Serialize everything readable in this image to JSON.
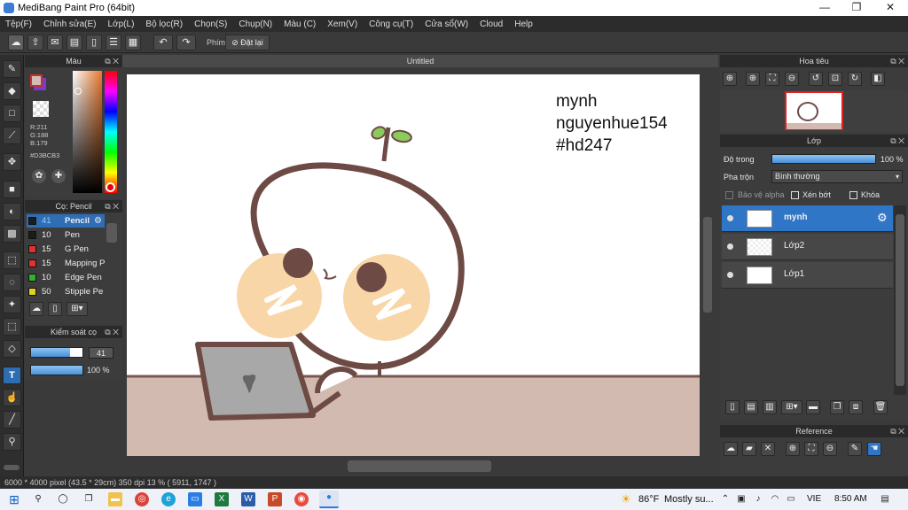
{
  "window": {
    "title": "MediBang Paint Pro (64bit)",
    "minimize": "—",
    "maximize": "❐",
    "close": "✕"
  },
  "menu": [
    "Tệp(F)",
    "Chỉnh sửa(E)",
    "Lớp(L)",
    "Bộ lọc(R)",
    "Chọn(S)",
    "Chụp(N)",
    "Màu (C)",
    "Xem(V)",
    "Công cụ(T)",
    "Cửa sổ(W)",
    "Cloud",
    "Help"
  ],
  "toolbar": {
    "shortcut_label": "Phím",
    "reset_label": "Đặt lại"
  },
  "color_panel": {
    "title": "Màu",
    "rgb_r": "R:211",
    "rgb_g": "G:188",
    "rgb_b": "B:179",
    "hex": "#D3BCB3",
    "fg_color": "#d3bcb3",
    "bg_color": "#7a3ad0"
  },
  "brush_panel": {
    "title": "Cọ: Pencil",
    "items": [
      {
        "size": "41",
        "name": "Pencil",
        "color": "#1c1c1c"
      },
      {
        "size": "10",
        "name": "Pen",
        "color": "#1c1c1c"
      },
      {
        "size": "15",
        "name": "G Pen",
        "color": "#e03030"
      },
      {
        "size": "15",
        "name": "Mapping P",
        "color": "#e03030"
      },
      {
        "size": "10",
        "name": "Edge Pen",
        "color": "#30b030"
      },
      {
        "size": "50",
        "name": "Stipple Pe",
        "color": "#e0d020"
      }
    ]
  },
  "control_panel": {
    "title": "Kiểm soát cọ",
    "size_value": "41",
    "opacity_value": "100 %",
    "size_fraction": 0.75,
    "opacity_fraction": 1.0
  },
  "document": {
    "tab": "Untitled",
    "text_line1": "mynh",
    "text_line2": "nguyenhue154",
    "text_line3": "#hd247"
  },
  "navigator": {
    "title": "Hoa tiêu"
  },
  "layers": {
    "title": "Lớp",
    "opacity_label": "Độ trong",
    "opacity_value": "100 %",
    "blend_label": "Pha trộn",
    "blend_value": "Bình thường",
    "protect_alpha": "Bảo vệ alpha",
    "clipping": "Xén bớt",
    "lock": "Khóa",
    "items": [
      {
        "name": "mynh",
        "selected": true
      },
      {
        "name": "Lớp2",
        "selected": false
      },
      {
        "name": "Lớp1",
        "selected": false
      }
    ]
  },
  "reference": {
    "title": "Reference"
  },
  "status": {
    "text": "6000 * 4000 pixel   (43.5 * 29cm)   350 dpi   13 %   ( 5911, 1747 )"
  },
  "taskbar": {
    "weather_temp": "86°F",
    "weather_desc": "Mostly su...",
    "lang": "VIE",
    "time": "8:50 AM"
  }
}
